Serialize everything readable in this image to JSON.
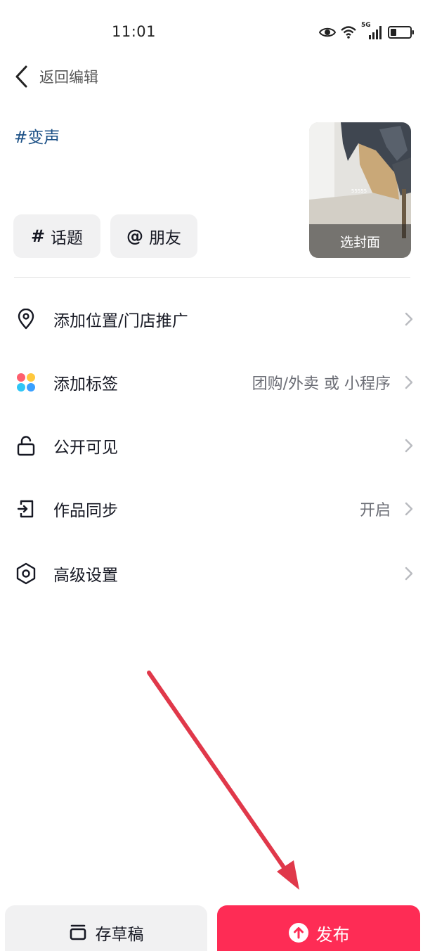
{
  "status_bar": {
    "time": "11:01",
    "network": "5G",
    "icons": [
      "eye-icon",
      "wifi-icon",
      "signal-icon",
      "battery-icon"
    ]
  },
  "header": {
    "back_label": "返回编辑"
  },
  "post": {
    "caption": "#变声",
    "chips": {
      "topic_symbol": "#",
      "topic_label": "话题",
      "friend_symbol": "@",
      "friend_label": "朋友"
    },
    "cover": {
      "label": "选封面",
      "overlay_text": "55555"
    }
  },
  "settings": [
    {
      "icon": "location-pin-icon",
      "label": "添加位置/门店推广",
      "value": ""
    },
    {
      "icon": "tag-dots-icon",
      "label": "添加标签",
      "value": "团购/外卖 或 小程序"
    },
    {
      "icon": "unlock-icon",
      "label": "公开可见",
      "value": ""
    },
    {
      "icon": "sync-icon",
      "label": "作品同步",
      "value": "开启"
    },
    {
      "icon": "hexagon-settings-icon",
      "label": "高级设置",
      "value": ""
    }
  ],
  "actions": {
    "draft_label": "存草稿",
    "publish_label": "发布"
  },
  "colors": {
    "accent": "#fe2c55",
    "caption": "#1a4f85",
    "annotation_arrow": "#e0384a",
    "tag_dots": [
      "#fe5f6e",
      "#ffc83d",
      "#2fc6f6",
      "#3aa0ff"
    ]
  }
}
